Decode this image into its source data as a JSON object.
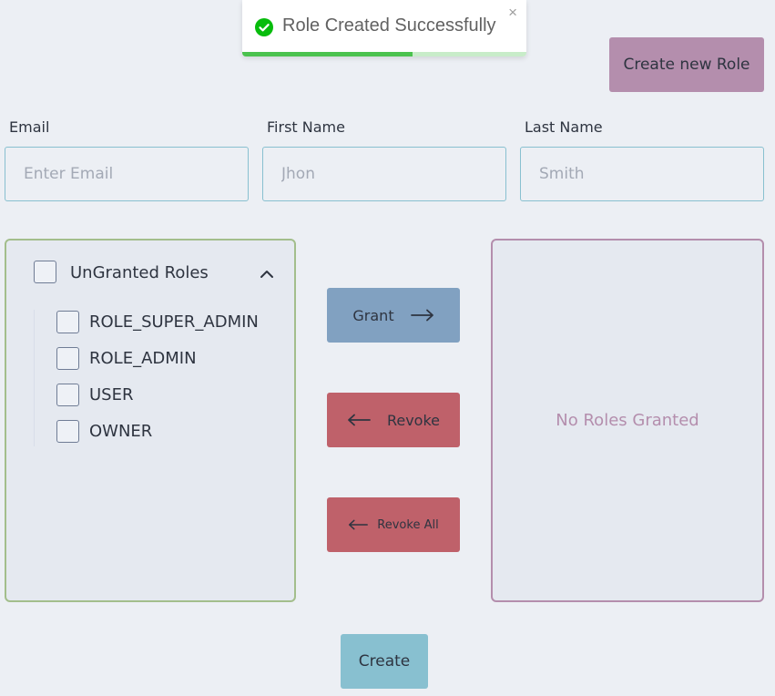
{
  "toast": {
    "message": "Role Created Successfully",
    "close": "×",
    "progress": 0.6
  },
  "header": {
    "create_role_label": "Create new Role"
  },
  "form": {
    "email": {
      "label": "Email",
      "placeholder": "Enter Email",
      "value": ""
    },
    "first_name": {
      "label": "First Name",
      "placeholder": "Jhon",
      "value": ""
    },
    "last_name": {
      "label": "Last Name",
      "placeholder": "Smith",
      "value": ""
    }
  },
  "ungranted": {
    "title": "UnGranted Roles",
    "roles": [
      "ROLE_SUPER_ADMIN",
      "ROLE_ADMIN",
      "USER",
      "OWNER"
    ]
  },
  "actions": {
    "grant": "Grant",
    "revoke": "Revoke",
    "revoke_all": "Revoke All"
  },
  "granted": {
    "empty_text": "No Roles Granted"
  },
  "footer": {
    "create_label": "Create"
  },
  "colors": {
    "background": "#eceff4",
    "accent_purple": "#b48ead",
    "accent_green": "#a3be8c",
    "grant_blue": "#81a1c1",
    "revoke_red": "#bf616a",
    "create_cyan": "#88c0d0",
    "toast_success": "#4bc24e"
  }
}
